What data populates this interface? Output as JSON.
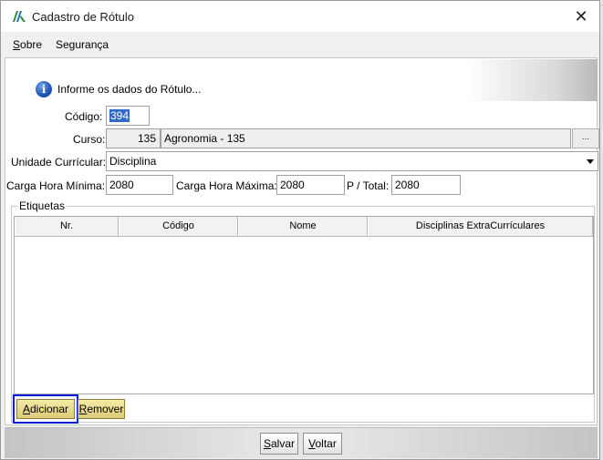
{
  "window": {
    "title": "Cadastro de Rótulo",
    "close_glyph": "✕",
    "icon": "app-logo-icon"
  },
  "menu": {
    "items": [
      {
        "first": "S",
        "rest": "obre"
      },
      {
        "first": "Segurança",
        "rest": ""
      }
    ]
  },
  "header": {
    "info_text": "Informe os dados do Rótulo...",
    "icon": "info-icon",
    "icon_glyph": "i"
  },
  "form": {
    "codigo_label": "Código:",
    "codigo_value": "394",
    "curso_label": "Curso:",
    "curso_code": "135",
    "curso_name": "Agronomia - 135",
    "curso_lookup": "...",
    "unidade_label": "Unidade Currícular:",
    "unidade_value": "Disciplina",
    "ch_min_label": "Carga Hora Mínima:",
    "ch_min_value": "2080",
    "ch_max_label": "Carga Hora Máxima:",
    "ch_max_value": "2080",
    "p_total_label": "P / Total:",
    "p_total_value": "2080"
  },
  "etiquetas": {
    "title": "Etiquetas",
    "columns": [
      "Nr.",
      "Código",
      "Nome",
      "Disciplinas ExtraCurrículares"
    ],
    "rows": []
  },
  "buttons": {
    "adicionar": {
      "first": "A",
      "rest": "dicionar"
    },
    "remover": {
      "first": "R",
      "rest": "emover"
    },
    "salvar": {
      "first": "S",
      "rest": "alvar"
    },
    "voltar": {
      "first": "V",
      "rest": "oltar"
    }
  },
  "colors": {
    "focus": "#0a1fd6",
    "button_gold": "#dccb76",
    "selection": "#316ac5"
  }
}
